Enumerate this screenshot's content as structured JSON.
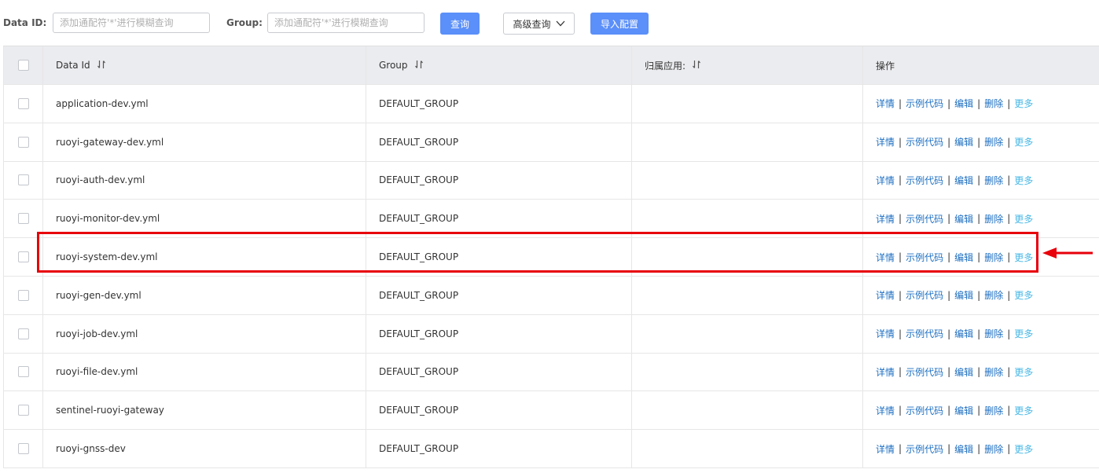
{
  "search": {
    "data_id_label": "Data ID:",
    "data_id_placeholder": "添加通配符'*'进行模糊查询",
    "group_label": "Group:",
    "group_placeholder": "添加通配符'*'进行模糊查询",
    "query_button": "查询",
    "advanced_button": "高级查询",
    "import_button": "导入配置"
  },
  "table": {
    "headers": {
      "data_id": "Data Id",
      "group": "Group",
      "app": "归属应用:",
      "ops": "操作"
    },
    "ops": {
      "detail": "详情",
      "sample": "示例代码",
      "edit": "编辑",
      "delete": "删除",
      "more": "更多",
      "separator": "|"
    },
    "rows": [
      {
        "data_id": "application-dev.yml",
        "group": "DEFAULT_GROUP",
        "app": ""
      },
      {
        "data_id": "ruoyi-gateway-dev.yml",
        "group": "DEFAULT_GROUP",
        "app": ""
      },
      {
        "data_id": "ruoyi-auth-dev.yml",
        "group": "DEFAULT_GROUP",
        "app": ""
      },
      {
        "data_id": "ruoyi-monitor-dev.yml",
        "group": "DEFAULT_GROUP",
        "app": ""
      },
      {
        "data_id": "ruoyi-system-dev.yml",
        "group": "DEFAULT_GROUP",
        "app": ""
      },
      {
        "data_id": "ruoyi-gen-dev.yml",
        "group": "DEFAULT_GROUP",
        "app": ""
      },
      {
        "data_id": "ruoyi-job-dev.yml",
        "group": "DEFAULT_GROUP",
        "app": ""
      },
      {
        "data_id": "ruoyi-file-dev.yml",
        "group": "DEFAULT_GROUP",
        "app": ""
      },
      {
        "data_id": "sentinel-ruoyi-gateway",
        "group": "DEFAULT_GROUP",
        "app": ""
      },
      {
        "data_id": "ruoyi-gnss-dev",
        "group": "DEFAULT_GROUP",
        "app": ""
      }
    ]
  },
  "annotation": {
    "highlight_color": "#e8000b",
    "highlighted_row": "ruoyi-system-dev.yml"
  },
  "colors": {
    "primary": "#5b8ff9",
    "link": "#1d6fc2",
    "more_link": "#49b8e6",
    "header_bg": "#ebecef"
  }
}
